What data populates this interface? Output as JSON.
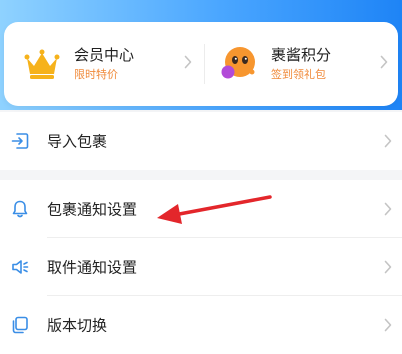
{
  "colors": {
    "gradient_start": "#8fd2ff",
    "gradient_end": "#1e84f6",
    "accent_orange": "#f08a3a",
    "annotation_red": "#e3262b",
    "icon_blue": "#3a8ee6"
  },
  "membership_card": {
    "vip": {
      "icon": "crown-icon",
      "title": "会员中心",
      "subtitle": "限时特价"
    },
    "points": {
      "icon": "mascot-icon",
      "title": "裹酱积分",
      "subtitle": "签到领礼包"
    }
  },
  "settings_list": [
    {
      "icon": "import-icon",
      "label": "导入包裹"
    },
    {
      "icon": "bell-icon",
      "label": "包裹通知设置"
    },
    {
      "icon": "speaker-icon",
      "label": "取件通知设置"
    },
    {
      "icon": "switch-version-icon",
      "label": "版本切换"
    }
  ]
}
